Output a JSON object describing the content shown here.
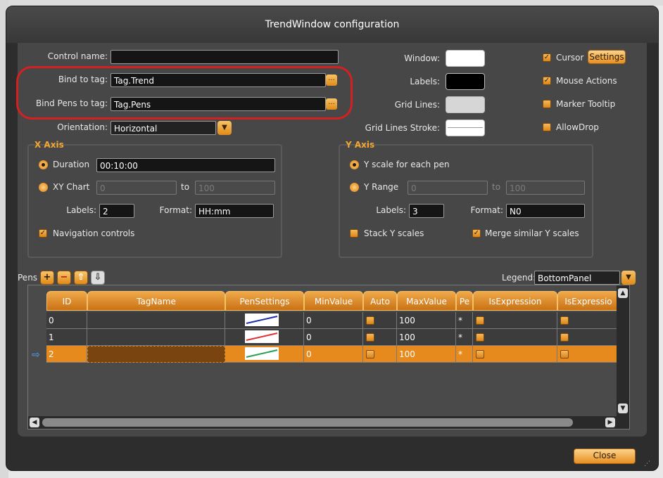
{
  "window": {
    "title": "TrendWindow configuration"
  },
  "general": {
    "control_name_label": "Control name:",
    "control_name_value": "",
    "bind_tag_label": "Bind to tag:",
    "bind_tag_value": "Tag.Trend",
    "bind_pens_label": "Bind Pens to tag:",
    "bind_pens_value": "Tag.Pens",
    "orientation_label": "Orientation:",
    "orientation_value": "Horizontal",
    "browse_glyph": "...",
    "dropdown_glyph": "▼"
  },
  "colors": {
    "window_label": "Window:",
    "labels_label": "Labels:",
    "grid_lines_label": "Grid Lines:",
    "grid_lines_stroke_label": "Grid Lines Stroke:",
    "window_color": "#ffffff",
    "labels_color": "#000000",
    "grid_lines_color": "#d6d6d6",
    "accent": "#e88f1f",
    "highlight_ring": "#d32020"
  },
  "options": {
    "cursor_label": "Cursor",
    "settings_button": "Settings",
    "mouse_actions_label": "Mouse Actions",
    "marker_tooltip_label": "Marker Tooltip",
    "allow_drop_label": "AllowDrop",
    "cursor_checked": true,
    "mouse_actions_checked": true,
    "marker_tooltip_checked": false,
    "allow_drop_checked": false
  },
  "x_axis": {
    "title": "X Axis",
    "duration_label": "Duration",
    "duration_value": "00:10:00",
    "xy_chart_label": "XY Chart",
    "xy_from": "0",
    "to_label": "to",
    "xy_to": "100",
    "labels_label": "Labels:",
    "labels_value": "2",
    "format_label": "Format:",
    "format_value": "HH:mm",
    "nav_controls_label": "Navigation controls"
  },
  "y_axis": {
    "title": "Y Axis",
    "scale_each_pen_label": "Y scale for each pen",
    "y_range_label": "Y Range",
    "range_from": "0",
    "to_label": "to",
    "range_to": "100",
    "labels_label": "Labels:",
    "labels_value": "3",
    "format_label": "Format:",
    "format_value": "N0",
    "stack_label": "Stack Y scales",
    "merge_label": "Merge similar Y scales"
  },
  "pens": {
    "label": "Pens",
    "add_glyph": "+",
    "remove_glyph": "−",
    "up_glyph": "⇧",
    "down_glyph": "⇩",
    "legend_label": "Legend:",
    "legend_value": "BottomPanel",
    "columns": [
      "ID",
      "TagName",
      "PenSettings",
      "MinValue",
      "Auto",
      "MaxValue",
      "Pe",
      "IsExpression",
      "IsExpressio"
    ],
    "rows": [
      {
        "id": "0",
        "tag": "",
        "min": "0",
        "max": "100",
        "pe": "*",
        "pen_color": "#1a2fb0"
      },
      {
        "id": "1",
        "tag": "",
        "min": "0",
        "max": "100",
        "pe": "*",
        "pen_color": "#e03030"
      },
      {
        "id": "2",
        "tag": "",
        "min": "0",
        "max": "100",
        "pe": "*",
        "pen_color": "#2aa04a"
      }
    ],
    "selected_row": 2,
    "current_row_glyph": "⇨"
  },
  "footer": {
    "close_button": "Close"
  }
}
